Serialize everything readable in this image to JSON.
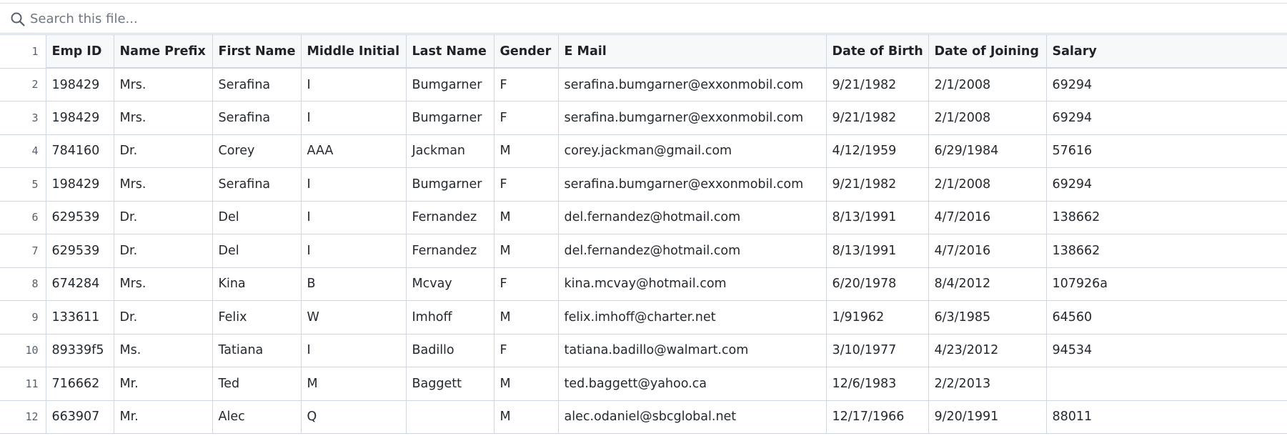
{
  "search": {
    "placeholder": "Search this file..."
  },
  "icons": {
    "search": "search-icon"
  },
  "colors": {
    "header_bg": "#f6f8fa",
    "border": "#d0d7de",
    "row_number": "#57606a"
  },
  "table": {
    "header_row_number": "1",
    "columns": [
      "Emp ID",
      "Name Prefix",
      "First Name",
      "Middle Initial",
      "Last Name",
      "Gender",
      "E Mail",
      "Date of Birth",
      "Date of Joining",
      "Salary"
    ],
    "rows": [
      {
        "n": "2",
        "cells": [
          "198429",
          "Mrs.",
          "Serafina",
          "I",
          "Bumgarner",
          "F",
          "serafina.bumgarner@exxonmobil.com",
          "9/21/1982",
          "2/1/2008",
          "69294"
        ]
      },
      {
        "n": "3",
        "cells": [
          "198429",
          "Mrs.",
          "Serafina",
          "I",
          "Bumgarner",
          "F",
          "serafina.bumgarner@exxonmobil.com",
          "9/21/1982",
          "2/1/2008",
          "69294"
        ]
      },
      {
        "n": "4",
        "cells": [
          "784160",
          "Dr.",
          "Corey",
          "AAA",
          "Jackman",
          "M",
          "corey.jackman@gmail.com",
          "4/12/1959",
          "6/29/1984",
          "57616"
        ]
      },
      {
        "n": "5",
        "cells": [
          "198429",
          "Mrs.",
          "Serafina",
          "I",
          "Bumgarner",
          "F",
          "serafina.bumgarner@exxonmobil.com",
          "9/21/1982",
          "2/1/2008",
          "69294"
        ]
      },
      {
        "n": "6",
        "cells": [
          "629539",
          "Dr.",
          "Del",
          "I",
          "Fernandez",
          "M",
          "del.fernandez@hotmail.com",
          "8/13/1991",
          "4/7/2016",
          "138662"
        ]
      },
      {
        "n": "7",
        "cells": [
          "629539",
          "Dr.",
          "Del",
          "I",
          "Fernandez",
          "M",
          "del.fernandez@hotmail.com",
          "8/13/1991",
          "4/7/2016",
          "138662"
        ]
      },
      {
        "n": "8",
        "cells": [
          "674284",
          "Mrs.",
          "Kina",
          "B",
          "Mcvay",
          "F",
          "kina.mcvay@hotmail.com",
          "6/20/1978",
          "8/4/2012",
          "107926a"
        ]
      },
      {
        "n": "9",
        "cells": [
          "133611",
          "Dr.",
          "Felix",
          "W",
          "Imhoff",
          "M",
          "felix.imhoff@charter.net",
          "1/91962",
          "6/3/1985",
          "64560"
        ]
      },
      {
        "n": "10",
        "cells": [
          "89339f5",
          "Ms.",
          "Tatiana",
          "I",
          "Badillo",
          "F",
          "tatiana.badillo@walmart.com",
          "3/10/1977",
          "4/23/2012",
          "94534"
        ]
      },
      {
        "n": "11",
        "cells": [
          "716662",
          "Mr.",
          "Ted",
          "M",
          "Baggett",
          "M",
          "ted.baggett@yahoo.ca",
          "12/6/1983",
          "2/2/2013",
          ""
        ]
      },
      {
        "n": "12",
        "cells": [
          "663907",
          "Mr.",
          "Alec",
          "Q",
          "",
          "M",
          "alec.odaniel@sbcglobal.net",
          "12/17/1966",
          "9/20/1991",
          "88011"
        ]
      }
    ]
  }
}
